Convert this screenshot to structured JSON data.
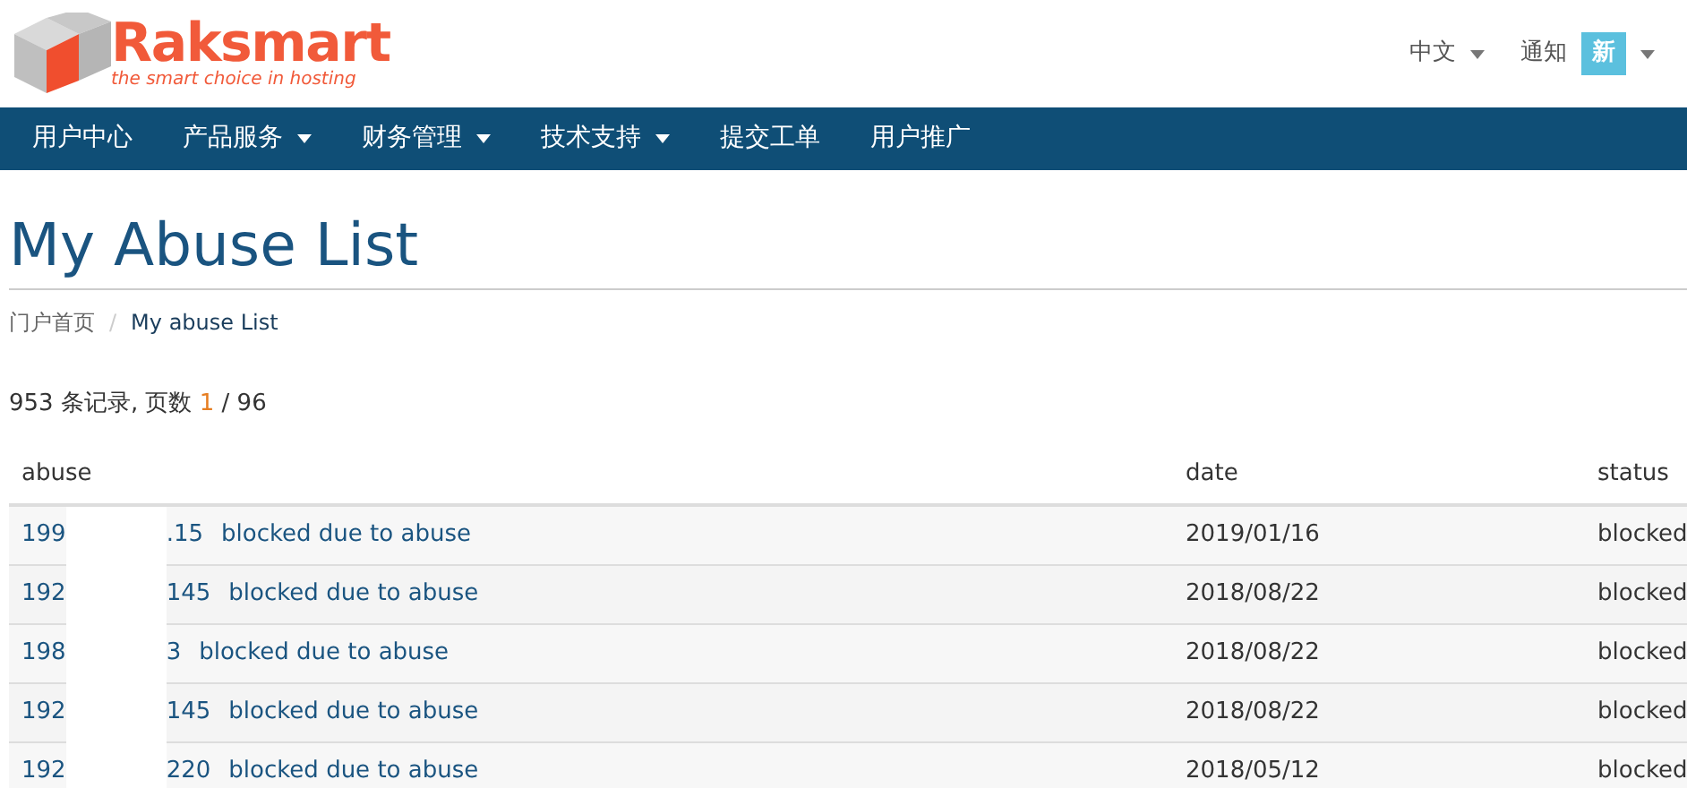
{
  "logo": {
    "name": "Raksmart",
    "tagline": "the smart choice in hosting"
  },
  "top_links": [
    {
      "label": "中文"
    },
    {
      "label": "通知",
      "badge": "新"
    }
  ],
  "nav": [
    {
      "label": "用户中心",
      "has_menu": false
    },
    {
      "label": "产品服务",
      "has_menu": true
    },
    {
      "label": "财务管理",
      "has_menu": true
    },
    {
      "label": "技术支持",
      "has_menu": true
    },
    {
      "label": "提交工单",
      "has_menu": false
    },
    {
      "label": "用户推广",
      "has_menu": false
    }
  ],
  "title": "My Abuse List",
  "breadcrumb_separator": "/",
  "breadcrumb": [
    {
      "label": "门户首页",
      "selected": false
    },
    {
      "label": "My abuse List",
      "selected": true
    }
  ],
  "pager": {
    "records": "953 条记录, 页数",
    "current": "1",
    "total": "/ 96"
  },
  "table": {
    "columns": [
      "abuse",
      "date",
      "status"
    ],
    "rows": [
      {
        "ip_start": "199",
        "ip_end": ".15",
        "link": "blocked due to abuse",
        "date": "2019/01/16",
        "status": "blocked"
      },
      {
        "ip_start": "192",
        "ip_end": "145",
        "link": "blocked due to abuse",
        "date": "2018/08/22",
        "status": "blocked"
      },
      {
        "ip_start": "198",
        "ip_end": "3",
        "link": "blocked due to abuse",
        "date": "2018/08/22",
        "status": "blocked"
      },
      {
        "ip_start": "192",
        "ip_end": "145",
        "link": "blocked due to abuse",
        "date": "2018/08/22",
        "status": "blocked"
      },
      {
        "ip_start": "192",
        "ip_end": "220",
        "link": "blocked due to abuse",
        "date": "2018/05/12",
        "status": "blocked"
      }
    ]
  }
}
